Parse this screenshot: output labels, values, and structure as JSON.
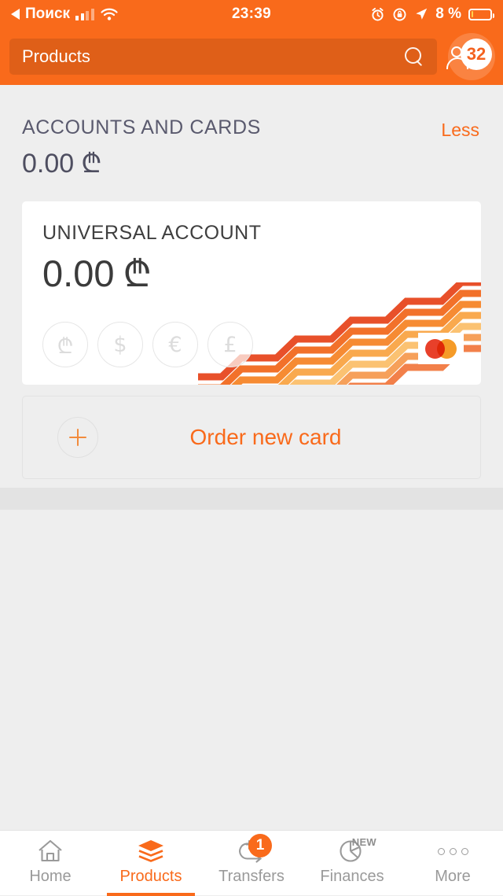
{
  "status_bar": {
    "carrier_back_label": "Поиск",
    "time": "23:39",
    "battery_percent": "8 %",
    "icons": [
      "back-arrow-icon",
      "signal-bars-icon",
      "wifi-icon",
      "alarm-clock-icon",
      "rotation-lock-icon",
      "location-arrow-icon",
      "battery-icon"
    ]
  },
  "header": {
    "search_value": "Products",
    "search_placeholder": "Products",
    "profile_badge_count": "32"
  },
  "section": {
    "title": "ACCOUNTS AND CARDS",
    "total_amount": "0.00",
    "currency_symbol": "₾",
    "toggle_label": "Less"
  },
  "account_card": {
    "name": "UNIVERSAL ACCOUNT",
    "amount": "0.00",
    "currency_symbol": "₾",
    "currencies": [
      {
        "symbol": "₾",
        "name": "lari"
      },
      {
        "symbol": "$",
        "name": "dollar"
      },
      {
        "symbol": "€",
        "name": "euro"
      },
      {
        "symbol": "£",
        "name": "pound"
      }
    ],
    "network": "mastercard"
  },
  "order_card": {
    "label": "Order new card"
  },
  "bottom_nav": [
    {
      "label": "Home",
      "icon": "house-icon",
      "active": false,
      "badge": "",
      "tag": ""
    },
    {
      "label": "Products",
      "icon": "layers-icon",
      "active": true,
      "badge": "",
      "tag": ""
    },
    {
      "label": "Transfers",
      "icon": "transfer-loop-icon",
      "active": false,
      "badge": "1",
      "tag": ""
    },
    {
      "label": "Finances",
      "icon": "pie-chart-icon",
      "active": false,
      "badge": "",
      "tag": "NEW"
    },
    {
      "label": "More",
      "icon": "ellipsis-icon",
      "active": false,
      "badge": "",
      "tag": ""
    }
  ],
  "colors": {
    "brand_orange": "#f96a1b",
    "page_bg": "#eeeeee",
    "card_bg": "#ffffff",
    "mastercard_red": "#e8402a",
    "mastercard_yellow": "#f59b28"
  }
}
